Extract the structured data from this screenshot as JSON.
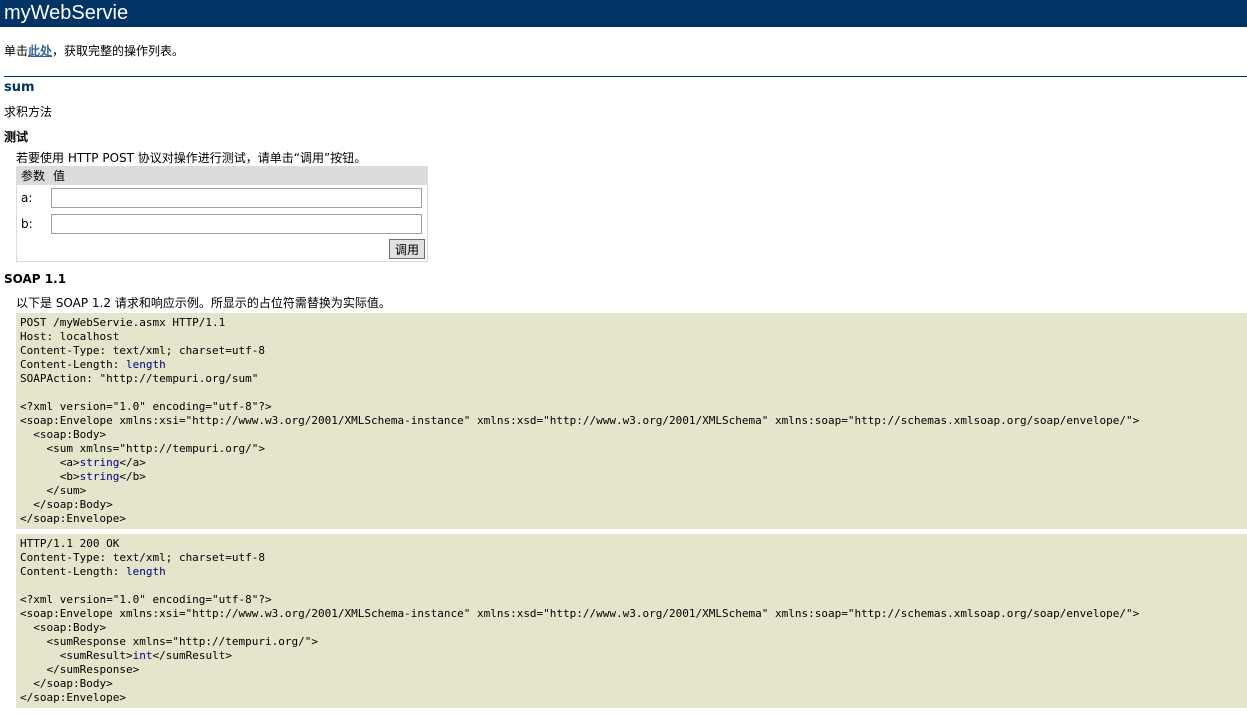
{
  "header": {
    "title": "myWebServie"
  },
  "intro": {
    "prefix": "单击",
    "link_label": "此处",
    "suffix": "，获取完整的操作列表。"
  },
  "operation": {
    "name": "sum",
    "description": "求积方法"
  },
  "test": {
    "heading": "测试",
    "description": "若要使用 HTTP POST 协议对操作进行测试，请单击“调用”按钮。",
    "col_param": "参数",
    "col_value": "值",
    "params": [
      {
        "label": "a:",
        "value": ""
      },
      {
        "label": "b:",
        "value": ""
      }
    ],
    "invoke_label": "调用"
  },
  "soap": {
    "heading": "SOAP 1.1",
    "description": "以下是 SOAP 1.2 请求和响应示例。所显示的占位符需替换为实际值。",
    "request": [
      {
        "t": "POST /myWebServie.asmx HTTP/1.1"
      },
      {
        "t": "Host: localhost"
      },
      {
        "t": "Content-Type: text/xml; charset=utf-8"
      },
      {
        "t": "Content-Length: ",
        "p": "length"
      },
      {
        "t": "SOAPAction: \"http://tempuri.org/sum\""
      },
      {
        "t": ""
      },
      {
        "t": "<?xml version=\"1.0\" encoding=\"utf-8\"?>"
      },
      {
        "t": "<soap:Envelope xmlns:xsi=\"http://www.w3.org/2001/XMLSchema-instance\" xmlns:xsd=\"http://www.w3.org/2001/XMLSchema\" xmlns:soap=\"http://schemas.xmlsoap.org/soap/envelope/\">"
      },
      {
        "t": "  <soap:Body>"
      },
      {
        "t": "    <sum xmlns=\"http://tempuri.org/\">"
      },
      {
        "t": "      <a>",
        "p": "string",
        "s": "</a>"
      },
      {
        "t": "      <b>",
        "p": "string",
        "s": "</b>"
      },
      {
        "t": "    </sum>"
      },
      {
        "t": "  </soap:Body>"
      },
      {
        "t": "</soap:Envelope>"
      }
    ],
    "response": [
      {
        "t": "HTTP/1.1 200 OK"
      },
      {
        "t": "Content-Type: text/xml; charset=utf-8"
      },
      {
        "t": "Content-Length: ",
        "p": "length"
      },
      {
        "t": ""
      },
      {
        "t": "<?xml version=\"1.0\" encoding=\"utf-8\"?>"
      },
      {
        "t": "<soap:Envelope xmlns:xsi=\"http://www.w3.org/2001/XMLSchema-instance\" xmlns:xsd=\"http://www.w3.org/2001/XMLSchema\" xmlns:soap=\"http://schemas.xmlsoap.org/soap/envelope/\">"
      },
      {
        "t": "  <soap:Body>"
      },
      {
        "t": "    <sumResponse xmlns=\"http://tempuri.org/\">"
      },
      {
        "t": "      <sumResult>",
        "p": "int",
        "s": "</sumResult>"
      },
      {
        "t": "    </sumResponse>"
      },
      {
        "t": "  </soap:Body>"
      },
      {
        "t": "</soap:Envelope>"
      }
    ]
  },
  "colors": {
    "header_bg": "#003366",
    "link": "#336699",
    "code_bg": "#e5e5cc",
    "placeholder": "#000080"
  }
}
